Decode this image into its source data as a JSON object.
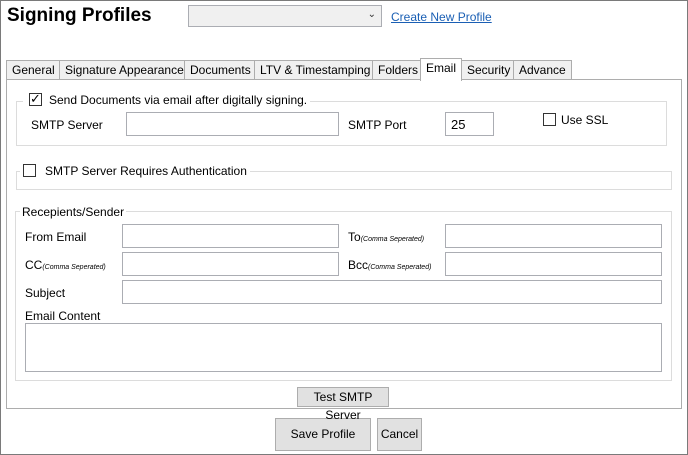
{
  "header": {
    "title": "Signing Profiles",
    "profile_select_value": "",
    "create_link": "Create New Profile"
  },
  "tabs": [
    {
      "label": "General"
    },
    {
      "label": "Signature Appearance"
    },
    {
      "label": "Documents"
    },
    {
      "label": "LTV & Timestamping"
    },
    {
      "label": "Folders"
    },
    {
      "label": "Email"
    },
    {
      "label": "Security"
    },
    {
      "label": "Advance"
    }
  ],
  "active_tab": "Email",
  "email": {
    "send_checkbox_label": "Send Documents via email after digitally signing.",
    "send_checked": true,
    "smtp_server_label": "SMTP Server",
    "smtp_server_value": "",
    "smtp_port_label": "SMTP Port",
    "smtp_port_value": "25",
    "ssl_label": "Use SSL",
    "ssl_checked": false,
    "auth_label": "SMTP Server Requires Authentication",
    "auth_checked": false
  },
  "recipients": {
    "group_title": "Recepients/Sender",
    "from_label": "From Email",
    "from_value": "",
    "to_label": "To",
    "to_note": "(Comma Seperated)",
    "to_value": "",
    "cc_label": "CC",
    "cc_note": "(Comma Seperated)",
    "cc_value": "",
    "bcc_label": "Bcc",
    "bcc_note": "(Comma Seperated)",
    "bcc_value": "",
    "subject_label": "Subject",
    "subject_value": "",
    "content_label": "Email Content",
    "content_value": ""
  },
  "buttons": {
    "test_smtp": "Test SMTP Server",
    "save": "Save Profile",
    "cancel": "Cancel"
  }
}
